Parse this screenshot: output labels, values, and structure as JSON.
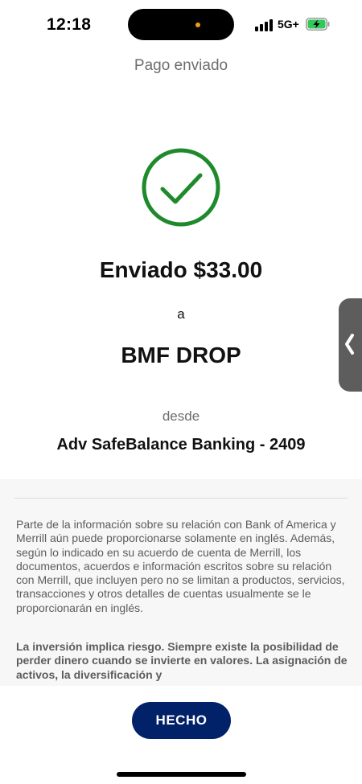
{
  "status_bar": {
    "time": "12:18",
    "network": "5G+",
    "battery_charging": true,
    "battery_color": "#34c759"
  },
  "header": {
    "title": "Pago enviado"
  },
  "confirmation": {
    "icon": "checkmark-circle-icon",
    "icon_color": "#1f8a2c",
    "sent_text": "Enviado $33.00",
    "to_text": "a",
    "recipient": "BMF DROP",
    "from_text": "desde",
    "account": "Adv SafeBalance Banking - 2409"
  },
  "disclosure": {
    "language_notice": "Parte de la información sobre su relación con Bank of America y Merrill aún puede proporcionarse solamente en inglés. Además, según lo indicado en su acuerdo de cuenta de Merrill, los documentos, acuerdos e información escritos sobre su relación con Merrill, que incluyen pero no se limitan a productos, servicios, transacciones y otros detalles de cuentas usualmente se le proporcionarán en inglés.",
    "risk_notice": "La inversión implica riesgo. Siempre existe la posibilidad de perder dinero cuando se invierte en valores. La asignación de activos, la diversificación y"
  },
  "footer": {
    "done_label": "HECHO",
    "button_color": "#012169"
  }
}
